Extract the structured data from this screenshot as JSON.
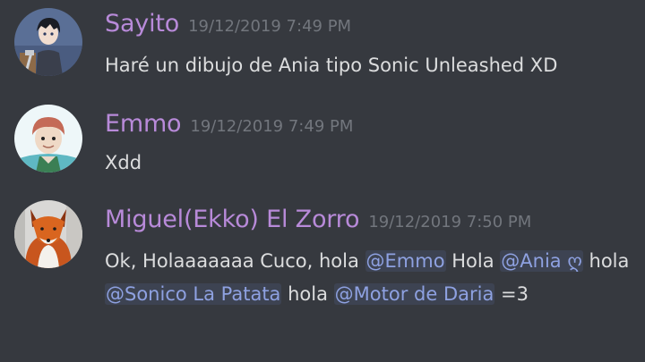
{
  "colors": {
    "background": "#36393f",
    "username": "#b88ad9",
    "timestamp": "#72767d",
    "text": "#dcddde",
    "mention": "#8ea1e1"
  },
  "messages": [
    {
      "username": "Sayito",
      "timestamp": "19/12/2019 7:49 PM",
      "avatar_icon": "anime-boy-avatar",
      "text": "Haré un dibujo de Ania tipo Sonic Unleashed XD"
    },
    {
      "username": "Emmo",
      "timestamp": "19/12/2019 7:49 PM",
      "avatar_icon": "cartoon-kid-avatar",
      "text": "Xdd"
    },
    {
      "username": "Miguel(Ekko) El Zorro",
      "timestamp": "19/12/2019 7:50 PM",
      "avatar_icon": "fox-avatar",
      "parts": {
        "p1": "Ok, Holaaaaaaa Cuco, hola ",
        "m1": "@Emmo",
        "p2": "  Hola ",
        "m2": "@Ania ღ",
        "p3": "  hola ",
        "m3": "@Sonico La Patata",
        "p4": "  hola ",
        "m4": "@Motor de Daria",
        "p5": "  =3"
      }
    }
  ]
}
